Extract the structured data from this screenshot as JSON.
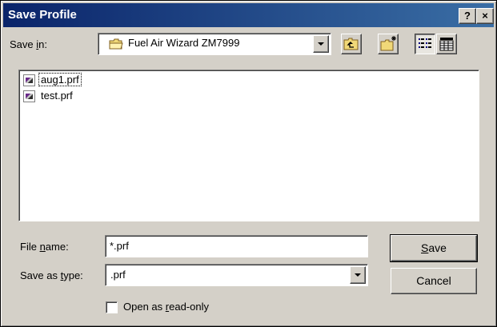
{
  "window": {
    "title": "Save Profile",
    "help_label": "?",
    "close_label": "×"
  },
  "save_in": {
    "label_pre": "Save ",
    "label_accel": "i",
    "label_post": "n:",
    "value": "Fuel Air Wizard ZM7999",
    "value_icon": "folder-icon"
  },
  "toolbar": {
    "up_folder_icon": "up-one-level-icon",
    "new_folder_icon": "create-new-folder-icon",
    "list_view_icon": "list-view-icon",
    "details_view_icon": "details-view-icon"
  },
  "files": [
    {
      "name": "aug1.prf",
      "icon": "profile-file-icon"
    },
    {
      "name": "test.prf",
      "icon": "profile-file-icon"
    }
  ],
  "file_name": {
    "label_pre": "File ",
    "label_accel": "n",
    "label_post": "ame:",
    "value": "*.prf"
  },
  "save_as_type": {
    "label_pre": "Save as ",
    "label_accel": "t",
    "label_post": "ype:",
    "value": ".prf"
  },
  "buttons": {
    "save_accel": "S",
    "save_rest": "ave",
    "cancel": "Cancel"
  },
  "read_only": {
    "label_pre": "Open as ",
    "label_accel": "r",
    "label_post": "ead-only",
    "checked": false
  }
}
